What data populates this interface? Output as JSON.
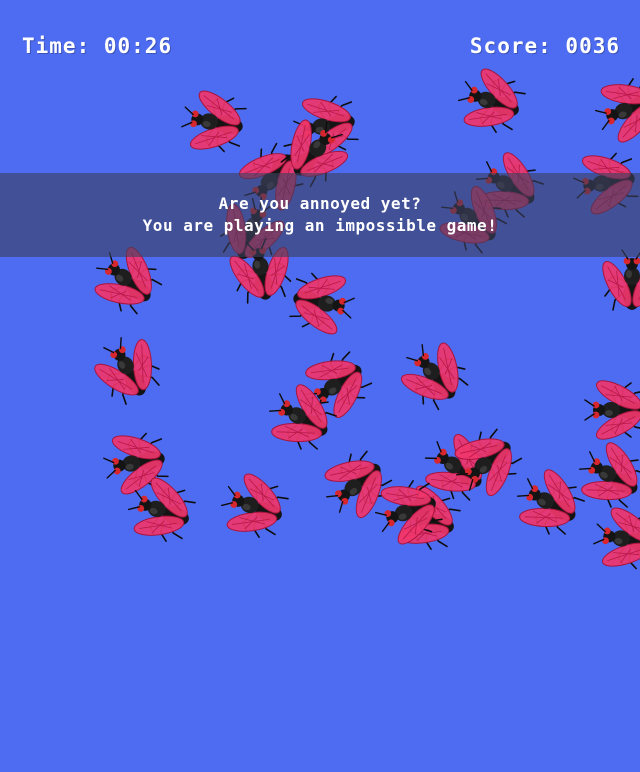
{
  "hud": {
    "time_label": "Time:",
    "time_value": "00:26",
    "score_label": "Score:",
    "score_value": "0036"
  },
  "message": {
    "line1": "Are you annoyed yet?",
    "line2": "You are playing an impossible game!"
  },
  "colors": {
    "background": "#4e6cf2",
    "wing": "#f0366c",
    "body": "#141414",
    "eye": "#d8262e",
    "banner": "#3c4060"
  },
  "fly_icon": "housefly-icon",
  "fly_count": 30
}
